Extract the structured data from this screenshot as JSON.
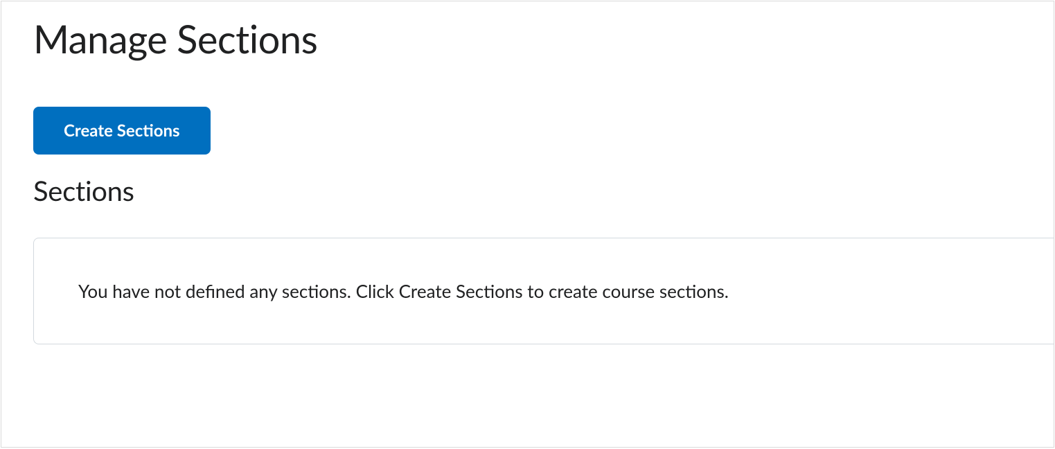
{
  "page": {
    "title": "Manage Sections"
  },
  "actions": {
    "create_label": "Create Sections"
  },
  "sections": {
    "heading": "Sections",
    "empty_message": "You have not defined any sections. Click Create Sections to create course sections."
  }
}
